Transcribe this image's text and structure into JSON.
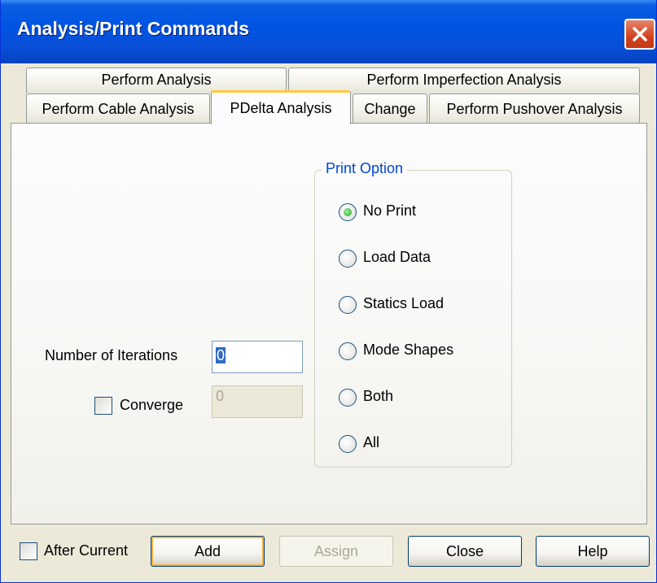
{
  "window": {
    "title": "Analysis/Print Commands"
  },
  "tabs": {
    "row1": [
      "Perform Analysis",
      "Perform Imperfection Analysis"
    ],
    "row2": [
      "Perform Cable Analysis",
      "PDelta Analysis",
      "Change",
      "Perform Pushover Analysis"
    ],
    "active": "PDelta Analysis"
  },
  "form": {
    "iterations_label": "Number of Iterations",
    "iterations_value": "0",
    "converge_label": "Converge",
    "converge_checked": false,
    "converge_value": "0"
  },
  "print_option": {
    "title": "Print Option",
    "options": [
      "No Print",
      "Load Data",
      "Statics Load",
      "Mode Shapes",
      "Both",
      "All"
    ],
    "selected": "No Print"
  },
  "footer": {
    "after_current_label": "After Current",
    "after_current_checked": false,
    "add_label": "Add",
    "assign_label": "Assign",
    "close_label": "Close",
    "help_label": "Help"
  },
  "colors": {
    "titlebar": "#0054e3",
    "active_tab_highlight": "#ffc83c",
    "group_title": "#0046d5",
    "radio_selected": "#21a121"
  }
}
